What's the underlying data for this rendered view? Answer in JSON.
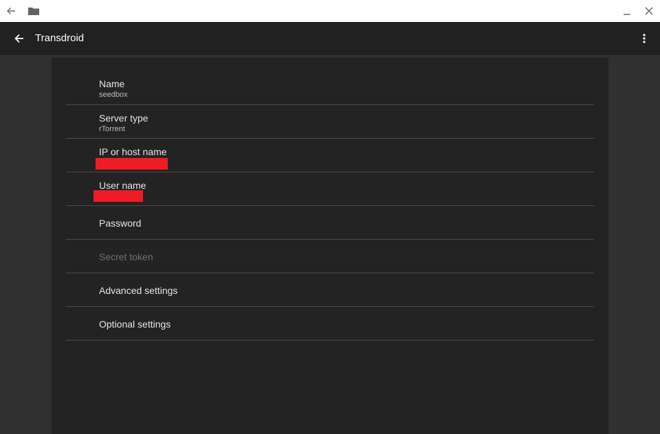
{
  "window": {
    "back_icon": "back-arrow-icon",
    "folder_icon": "folder-icon",
    "minimize_icon": "minimize-icon",
    "close_icon": "close-icon"
  },
  "app_bar": {
    "title": "Transdroid",
    "back_icon": "back-arrow-icon",
    "menu_icon": "overflow-menu-icon"
  },
  "settings": {
    "name": {
      "label": "Name",
      "summary": "seedbox"
    },
    "server_type": {
      "label": "Server type",
      "summary": "rTorrent"
    },
    "host": {
      "label": "IP or host name",
      "summary_redacted": true
    },
    "user": {
      "label": "User name",
      "summary_redacted": true
    },
    "password": {
      "label": "Password"
    },
    "secret_token": {
      "label": "Secret token",
      "enabled": false
    },
    "advanced": {
      "label": "Advanced settings"
    },
    "optional": {
      "label": "Optional settings"
    }
  },
  "colors": {
    "app_bar": "#212121",
    "background": "#303030",
    "card": "#232323",
    "redaction": "#ee1c25"
  }
}
